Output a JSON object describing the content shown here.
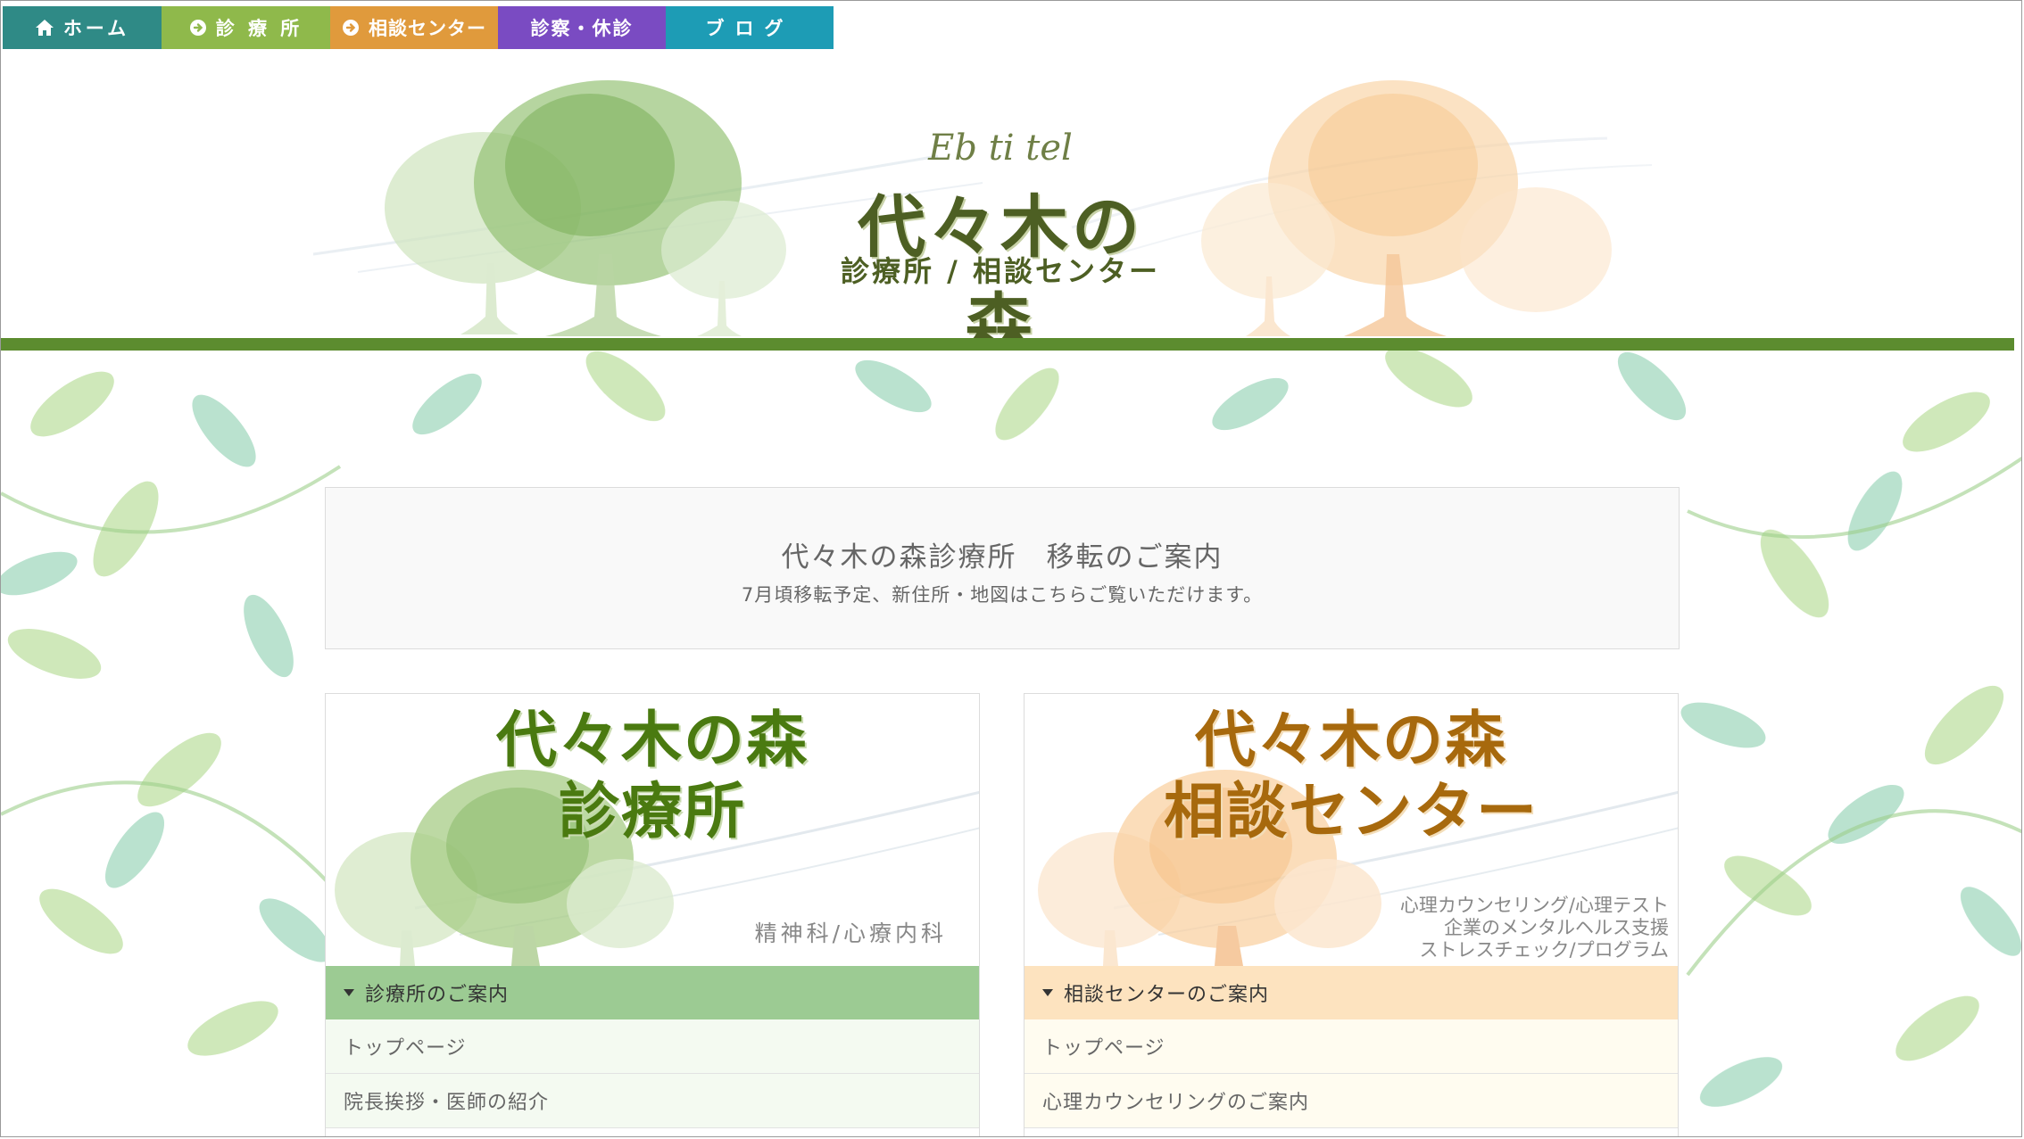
{
  "nav": {
    "items": [
      {
        "label": "ホーム",
        "icon": "home-icon"
      },
      {
        "label": "診 療 所",
        "icon": "arrow-circle-right-icon"
      },
      {
        "label": "相談センター",
        "icon": "arrow-circle-right-icon"
      },
      {
        "label": "診察・休診"
      },
      {
        "label": "ブログ"
      }
    ]
  },
  "header": {
    "logo_script": "Eb ti tel",
    "logo_main": "代々木の森",
    "logo_sub": "診療所 / 相談センター"
  },
  "notice": {
    "title": "代々木の森診療所　移転のご案内",
    "text": "7月頃移転予定、新住所・地図はこちらご覧いただけます。"
  },
  "cards": [
    {
      "title_line1": "代々木の森",
      "title_line2": "診療所",
      "caption": "精神科/心療内科",
      "section": "診療所のご案内",
      "rows": [
        "トップページ",
        "院長挨拶・医師の紹介"
      ]
    },
    {
      "title_line1": "代々木の森",
      "title_line2": "相談センター",
      "caption_lines": [
        "心理カウンセリング/心理テスト",
        "企業のメンタルヘルス支援",
        "ストレスチェック/プログラム"
      ],
      "section": "相談センターのご案内",
      "rows": [
        "トップページ",
        "心理カウンセリングのご案内"
      ]
    }
  ],
  "colors": {
    "nav_home": "#2f8a86",
    "nav_clinic": "#8fb94b",
    "nav_center": "#e09a3c",
    "nav_hours": "#7a4bc2",
    "nav_blog": "#1d9cb5",
    "header_line": "#5c8c2f",
    "clinic_section": "#9ccb93",
    "center_section": "#fde3bf"
  }
}
